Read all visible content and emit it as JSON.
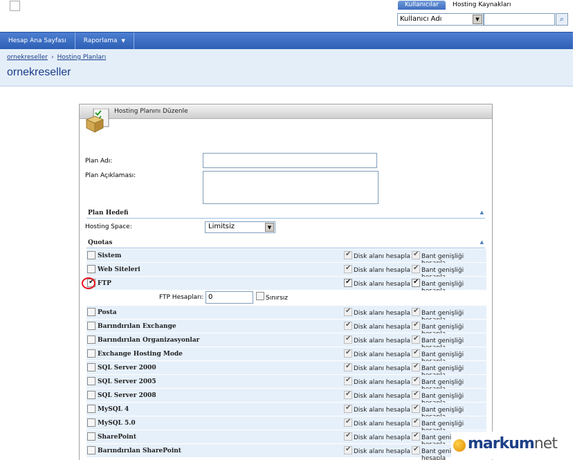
{
  "top": {
    "tabs": [
      {
        "label": "Kullanıcılar",
        "active": true
      },
      {
        "label": "Hosting Kaynakları",
        "active": false
      }
    ],
    "search": {
      "select_value": "Kullanıcı Adı",
      "input_value": ""
    }
  },
  "nav": {
    "items": [
      {
        "label": "Hesap Ana Sayfası"
      },
      {
        "label": "Raporlama"
      }
    ]
  },
  "header": {
    "breadcrumb": [
      "ornekreseller",
      "Hosting Planları"
    ],
    "title": "ornekreseller"
  },
  "panel": {
    "title": "Hosting Planını Düzenle",
    "plan_name_label": "Plan Adı:",
    "plan_desc_label": "Plan Açıklaması:",
    "plan_target_section": "Plan Hedefi",
    "hosting_space_label": "Hosting Space:",
    "hosting_space_value": "Limitsiz",
    "quotas_section": "Quotas",
    "disk_label": "Disk alanı hesapla",
    "bandwidth_label": "Bant genişliği hesapla",
    "quotas": [
      {
        "label": "Sistem",
        "checked": false,
        "disk": true,
        "bw": true,
        "active": false
      },
      {
        "label": "Web Siteleri",
        "checked": false,
        "disk": true,
        "bw": true,
        "active": false
      },
      {
        "label": "FTP",
        "checked": true,
        "disk": true,
        "bw": true,
        "active": true
      },
      {
        "label": "Posta",
        "checked": false,
        "disk": true,
        "bw": true,
        "active": false
      },
      {
        "label": "Barındırılan Exchange",
        "checked": false,
        "disk": true,
        "bw": true,
        "active": false
      },
      {
        "label": "Barındırılan Organizasyonlar",
        "checked": false,
        "disk": true,
        "bw": true,
        "active": false
      },
      {
        "label": "Exchange Hosting Mode",
        "checked": false,
        "disk": true,
        "bw": true,
        "active": false
      },
      {
        "label": "SQL Server 2000",
        "checked": false,
        "disk": true,
        "bw": true,
        "active": false
      },
      {
        "label": "SQL Server 2005",
        "checked": false,
        "disk": true,
        "bw": true,
        "active": false
      },
      {
        "label": "SQL Server 2008",
        "checked": false,
        "disk": true,
        "bw": true,
        "active": false
      },
      {
        "label": "MySQL 4",
        "checked": false,
        "disk": true,
        "bw": true,
        "active": false
      },
      {
        "label": "MySQL 5.0",
        "checked": false,
        "disk": true,
        "bw": true,
        "active": false
      },
      {
        "label": "SharePoint",
        "checked": false,
        "disk": true,
        "bw": true,
        "active": false
      },
      {
        "label": "Barındırılan SharePoint",
        "checked": false,
        "disk": true,
        "bw": true,
        "active": false
      }
    ],
    "ftp_sub": {
      "label": "FTP Hesapları:",
      "value": "0",
      "unlimited_label": "Sınırsız"
    }
  },
  "watermark": {
    "brand": "markum",
    "suffix": "net"
  }
}
